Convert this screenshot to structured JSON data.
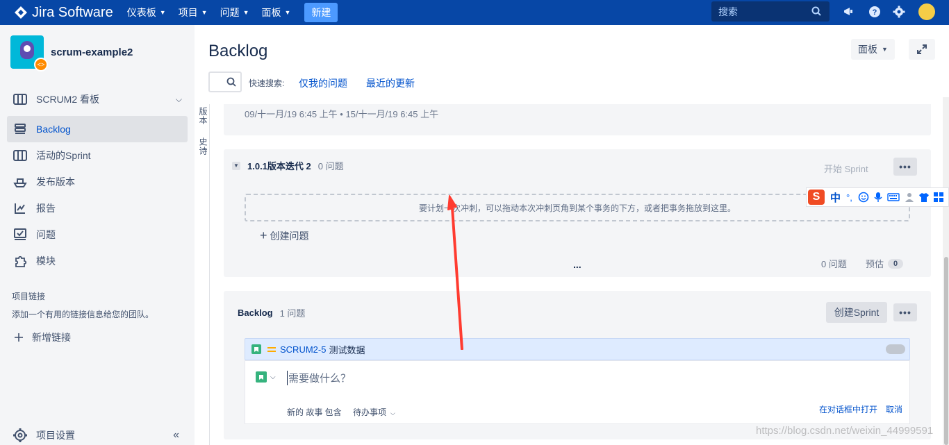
{
  "topnav": {
    "brand": "Jira Software",
    "items": [
      {
        "label": "仪表板"
      },
      {
        "label": "项目"
      },
      {
        "label": "问题"
      },
      {
        "label": "面板"
      }
    ],
    "create_label": "新建",
    "search_placeholder": "搜索"
  },
  "sidebar": {
    "project_name": "scrum-example2",
    "board_label": "SCRUM2 看板",
    "items": [
      {
        "label": "Backlog",
        "icon": "backlog-icon"
      },
      {
        "label": "活动的Sprint",
        "icon": "board-icon"
      },
      {
        "label": "发布版本",
        "icon": "ship-icon"
      },
      {
        "label": "报告",
        "icon": "chart-icon"
      },
      {
        "label": "问题",
        "icon": "issues-icon"
      },
      {
        "label": "模块",
        "icon": "puzzle-icon"
      }
    ],
    "project_links_title": "项目链接",
    "project_links_desc": "添加一个有用的链接信息给您的团队。",
    "add_link_label": "新增链接",
    "settings_label": "项目设置"
  },
  "main": {
    "title": "Backlog",
    "board_button": "面板",
    "quick_search_label": "快速搜索:",
    "quick_filters": [
      "仅我的问题",
      "最近的更新"
    ],
    "vertical_tabs": [
      "版本",
      "史诗"
    ],
    "first_sprint_dates": "09/十一月/19 6:45 上午 • 15/十一月/19 6:45 上午",
    "sprint": {
      "name": "1.0.1版本迭代 2",
      "count": "0 问题",
      "start_label": "开始 Sprint",
      "more_label": "•••",
      "drop_hint": "要计划一次冲刺，可以拖动本次冲刺页角到某个事务的下方，或者把事务拖放到这里。",
      "create_issue": "创建问题",
      "dots": "...",
      "footer_count": "0 问题",
      "estimate_label": "预估",
      "estimate_value": "0"
    },
    "backlog": {
      "name": "Backlog",
      "count": "1 问题",
      "create_sprint": "创建Sprint",
      "more_label": "•••",
      "issue": {
        "key": "SCRUM2-5",
        "summary": "测试数据"
      },
      "composer": {
        "placeholder": "需要做什么？",
        "meta": "新的 故事 包含",
        "status": "待办事项",
        "open_in_dialog": "在对话框中打开",
        "cancel": "取消"
      }
    }
  },
  "ime": {
    "zh": "中",
    "punct": "°,"
  },
  "watermark": "https://blog.csdn.net/weixin_44999591",
  "colors": {
    "nav_bg": "#0747a6",
    "accent": "#0052cc",
    "story_green": "#36b37e",
    "annotation_red": "#ff3b30"
  }
}
